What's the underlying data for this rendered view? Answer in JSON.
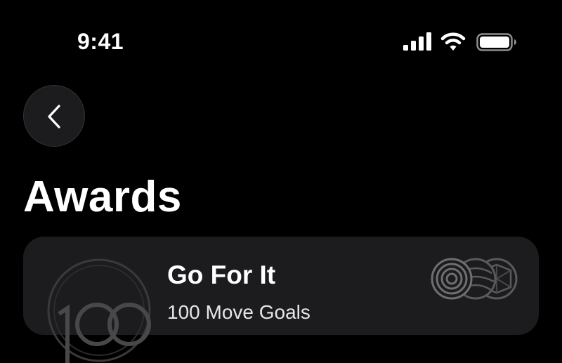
{
  "status_bar": {
    "time": "9:41",
    "icons": [
      "signal-icon",
      "wifi-icon",
      "battery-icon"
    ]
  },
  "nav": {
    "back_icon": "chevron-left-icon"
  },
  "page": {
    "title": "Awards"
  },
  "award": {
    "title": "Go For It",
    "subtitle": "100 Move Goals",
    "badge_icon": "award-100-badge-icon",
    "stack_icons": [
      "badge-rings-icon",
      "badge-sphere-icon",
      "badge-geo-icon"
    ]
  },
  "colors": {
    "background": "#000000",
    "card": "#1c1c1e",
    "text": "#ffffff"
  }
}
